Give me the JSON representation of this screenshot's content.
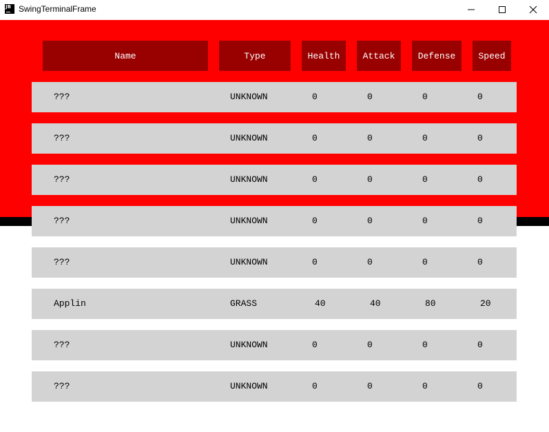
{
  "window": {
    "title": "SwingTerminalFrame",
    "icon_text": "JB"
  },
  "table": {
    "headers": [
      "Name",
      "Type",
      "Health",
      "Attack",
      "Defense",
      "Speed"
    ],
    "rows": [
      {
        "name": "???",
        "type": "UNKNOWN",
        "health": "0",
        "attack": "0",
        "defense": "0",
        "speed": "0"
      },
      {
        "name": "???",
        "type": "UNKNOWN",
        "health": "0",
        "attack": "0",
        "defense": "0",
        "speed": "0"
      },
      {
        "name": "???",
        "type": "UNKNOWN",
        "health": "0",
        "attack": "0",
        "defense": "0",
        "speed": "0"
      },
      {
        "name": "???",
        "type": "UNKNOWN",
        "health": "0",
        "attack": "0",
        "defense": "0",
        "speed": "0"
      },
      {
        "name": "???",
        "type": "UNKNOWN",
        "health": "0",
        "attack": "0",
        "defense": "0",
        "speed": "0"
      },
      {
        "name": "Applin",
        "type": "GRASS",
        "health": "40",
        "attack": "40",
        "defense": "80",
        "speed": "20"
      },
      {
        "name": "???",
        "type": "UNKNOWN",
        "health": "0",
        "attack": "0",
        "defense": "0",
        "speed": "0"
      },
      {
        "name": "???",
        "type": "UNKNOWN",
        "health": "0",
        "attack": "0",
        "defense": "0",
        "speed": "0"
      }
    ]
  },
  "colors": {
    "background_red": "#ff0000",
    "header_cell": "#990000",
    "row_background": "#d3d3d3",
    "band": "#000000"
  }
}
